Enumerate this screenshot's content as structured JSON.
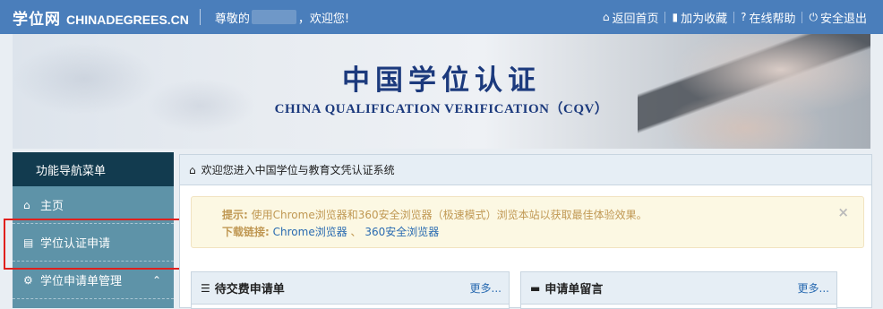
{
  "topbar": {
    "brand_cn": "学位网",
    "brand_en": "CHINADEGREES.CN",
    "greeting_prefix": "尊敬的",
    "greeting_suffix": "，欢迎您!",
    "links": [
      {
        "icon": "home-icon",
        "glyph": "⌂",
        "label": "返回首页"
      },
      {
        "icon": "bookmark-icon",
        "glyph": "▮",
        "label": "加为收藏"
      },
      {
        "icon": "help-icon",
        "glyph": "?",
        "label": "在线帮助"
      },
      {
        "icon": "power-icon",
        "glyph": "⏻",
        "label": "安全退出"
      }
    ]
  },
  "banner": {
    "title": "中国学位认证",
    "subtitle": "CHINA QUALIFICATION VERIFICATION（CQV）"
  },
  "sidebar": {
    "header": "功能导航菜单",
    "items": [
      {
        "icon": "home-icon",
        "glyph": "⌂",
        "label": "主页"
      },
      {
        "icon": "file-icon",
        "glyph": "▤",
        "label": "学位认证申请"
      },
      {
        "icon": "gear-icon",
        "glyph": "⚙",
        "label": "学位申请单管理",
        "chevron": "⌃"
      }
    ]
  },
  "main": {
    "header_icon": "⌂",
    "header": "欢迎您进入中国学位与教育文凭认证系统",
    "alert": {
      "tip_label": "提示:",
      "tip_text": "使用Chrome浏览器和360安全浏览器（极速模式）浏览本站以获取最佳体验效果。",
      "download_label": "下载链接:",
      "link_chrome": "Chrome浏览器",
      "link_sep": "、",
      "link_360": "360安全浏览器",
      "close": "×"
    },
    "panels": [
      {
        "icon": "list-icon",
        "glyph": "☰",
        "title": "待交费申请单",
        "more": "更多..."
      },
      {
        "icon": "comment-icon",
        "glyph": "▬",
        "title": "申请单留言",
        "more": "更多..."
      }
    ]
  },
  "colors": {
    "topbar": "#4a7ebb",
    "sidebar": "#5e93a8",
    "sidebar_header": "#123b4f",
    "highlight": "#e0201d",
    "banner_title": "#1c3a7d",
    "alert_text": "#c09853"
  }
}
